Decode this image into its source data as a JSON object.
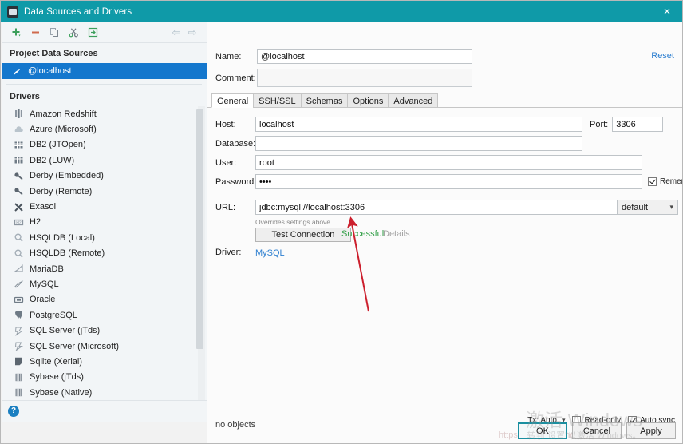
{
  "window": {
    "title": "Data Sources and Drivers",
    "app_icon": "intellij-db-icon",
    "close_label": "×"
  },
  "sidebar": {
    "toolbar": [
      {
        "name": "add-data-source-button",
        "icon": "plus-icon",
        "label": "+"
      },
      {
        "name": "remove-data-source-button",
        "icon": "minus-icon",
        "label": "−"
      },
      {
        "name": "duplicate-data-source-button",
        "icon": "copy-icon",
        "label": "copy"
      },
      {
        "name": "cut-data-source-button",
        "icon": "scissors-icon",
        "label": "cut"
      },
      {
        "name": "import-data-source-button",
        "icon": "import-icon",
        "label": "import"
      }
    ],
    "nav_back": "⇦",
    "nav_forward": "⇨",
    "project_section_label": "Project Data Sources",
    "data_sources": [
      {
        "label": "@localhost",
        "icon": "mysql-icon",
        "selected": true
      }
    ],
    "drivers_section_label": "Drivers",
    "drivers": [
      {
        "label": "Amazon Redshift",
        "icon": "redshift-icon"
      },
      {
        "label": "Azure (Microsoft)",
        "icon": "azure-cloud-icon"
      },
      {
        "label": "DB2 (JTOpen)",
        "icon": "db2-icon"
      },
      {
        "label": "DB2 (LUW)",
        "icon": "db2-icon"
      },
      {
        "label": "Derby (Embedded)",
        "icon": "derby-icon"
      },
      {
        "label": "Derby (Remote)",
        "icon": "derby-icon"
      },
      {
        "label": "Exasol",
        "icon": "exasol-x-icon"
      },
      {
        "label": "H2",
        "icon": "h2-icon"
      },
      {
        "label": "HSQLDB (Local)",
        "icon": "hsqldb-icon"
      },
      {
        "label": "HSQLDB (Remote)",
        "icon": "hsqldb-icon"
      },
      {
        "label": "MariaDB",
        "icon": "mariadb-icon"
      },
      {
        "label": "MySQL",
        "icon": "mysql-dolphin-icon"
      },
      {
        "label": "Oracle",
        "icon": "oracle-icon"
      },
      {
        "label": "PostgreSQL",
        "icon": "postgresql-elephant-icon"
      },
      {
        "label": "SQL Server (jTds)",
        "icon": "sqlserver-icon"
      },
      {
        "label": "SQL Server (Microsoft)",
        "icon": "sqlserver-icon"
      },
      {
        "label": "Sqlite (Xerial)",
        "icon": "sqlite-icon"
      },
      {
        "label": "Sybase (jTds)",
        "icon": "sybase-icon"
      },
      {
        "label": "Sybase (Native)",
        "icon": "sybase-icon"
      }
    ],
    "help_icon_label": "?"
  },
  "form": {
    "name_label": "Name:",
    "name_value": "@localhost",
    "comment_label": "Comment:",
    "comment_value": "",
    "reset_label": "Reset",
    "tabs": [
      {
        "label": "General",
        "active": true
      },
      {
        "label": "SSH/SSL",
        "active": false
      },
      {
        "label": "Schemas",
        "active": false
      },
      {
        "label": "Options",
        "active": false
      },
      {
        "label": "Advanced",
        "active": false
      }
    ],
    "host_label": "Host:",
    "host_value": "localhost",
    "port_label": "Port:",
    "port_value": "3306",
    "database_label": "Database:",
    "database_value": "",
    "user_label": "User:",
    "user_value": "root",
    "password_label": "Password:",
    "password_value": "••••",
    "remember_password_label": "Remember password",
    "remember_password_checked": true,
    "url_label": "URL:",
    "url_value": "jdbc:mysql://localhost:3306",
    "url_hint": "Overrides settings above",
    "url_mode_value": "default",
    "test_connection_label": "Test Connection",
    "test_status": "Successful",
    "test_status_color": "#2f9e44",
    "details_label": "Details",
    "driver_label": "Driver:",
    "driver_value": "MySQL"
  },
  "footer": {
    "objects_status": "no objects",
    "tx_label": "Tx: Auto",
    "read_only_label": "Read-only",
    "read_only_checked": false,
    "auto_sync_label": "Auto sync",
    "auto_sync_checked": true,
    "buttons": [
      {
        "label": "OK",
        "default": true
      },
      {
        "label": "Cancel",
        "default": false
      },
      {
        "label": "Apply",
        "default": false
      }
    ]
  },
  "watermark": {
    "line1": "激活 Windows",
    "line2": "转到“设置”以激活 Windows。",
    "url_ghost": "https://blog.csdn.net"
  },
  "annotation": {
    "arrow_color": "#cc1f2d"
  }
}
